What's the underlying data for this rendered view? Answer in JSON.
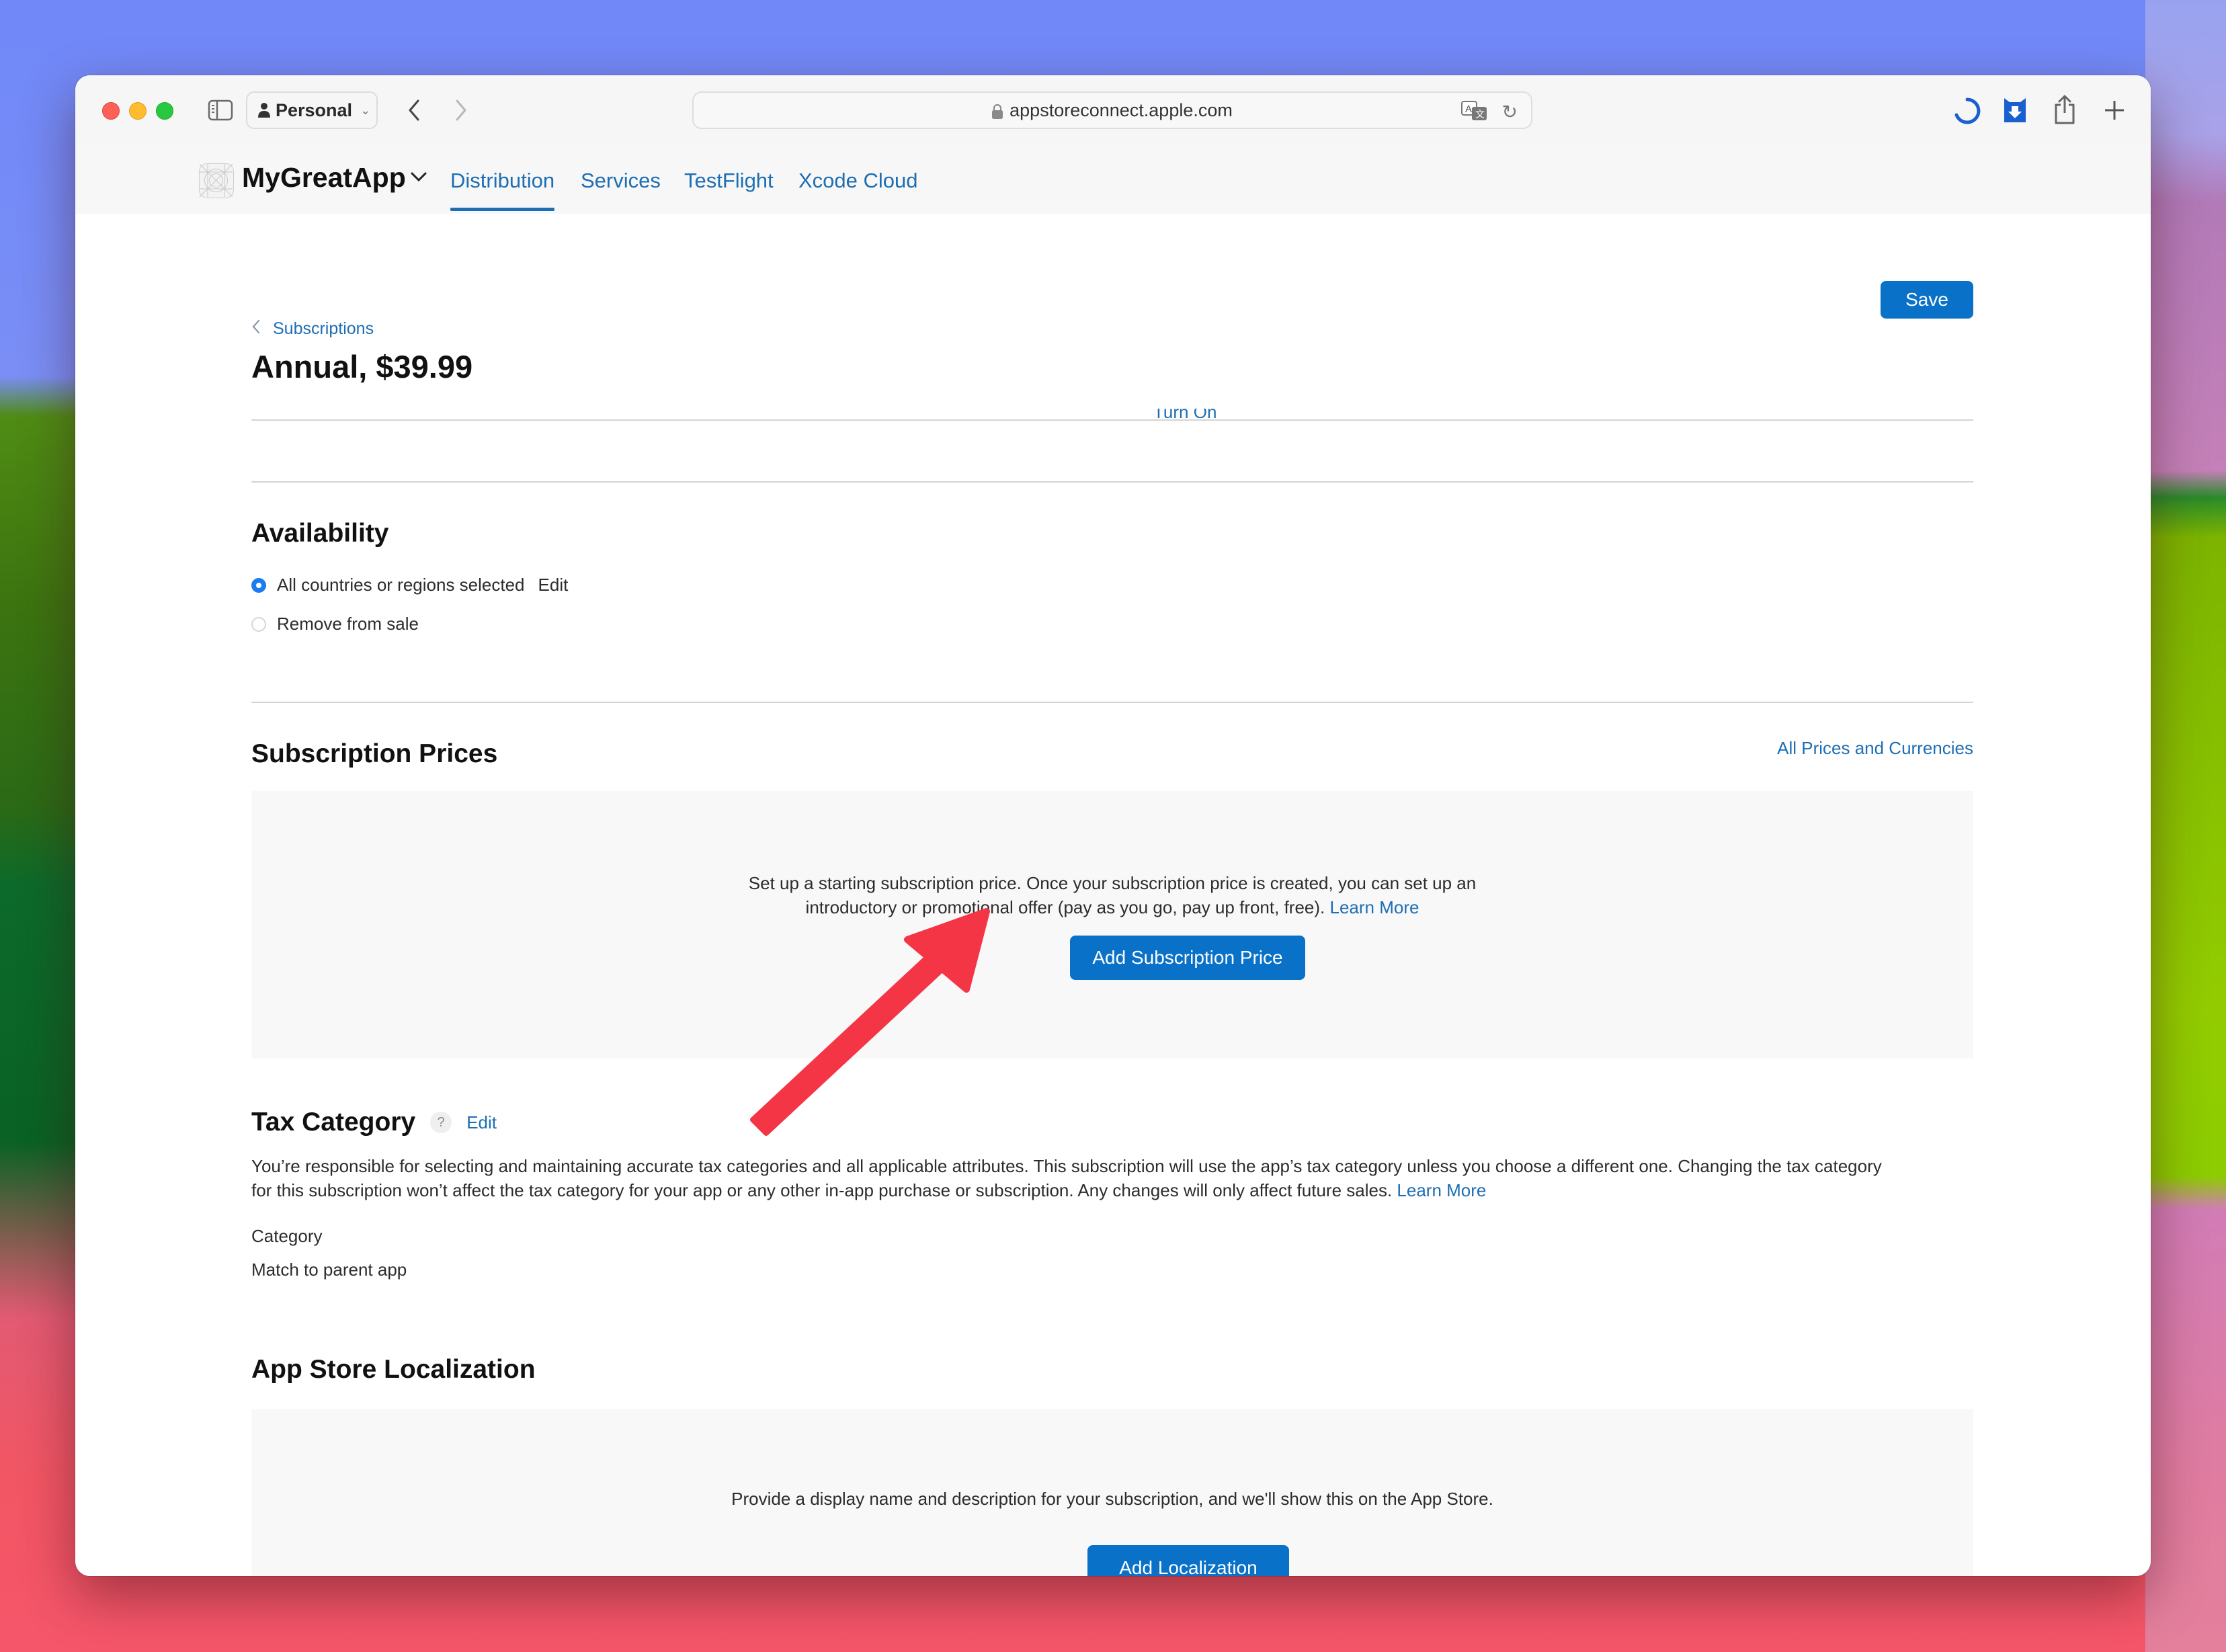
{
  "browser": {
    "profile_label": "Personal",
    "url": "appstoreconnect.apple.com",
    "accent": "#1a5fd0"
  },
  "app_header": {
    "app_name": "MyGreatApp",
    "tabs": [
      {
        "label": "Distribution",
        "active": true
      },
      {
        "label": "Services",
        "active": false
      },
      {
        "label": "TestFlight",
        "active": false
      },
      {
        "label": "Xcode Cloud",
        "active": false
      }
    ]
  },
  "page": {
    "breadcrumb": "Subscriptions",
    "title": "Annual, $39.99",
    "save_label": "Save",
    "clipped_link": "Turn On"
  },
  "availability": {
    "heading": "Availability",
    "options": [
      {
        "label": "All countries or regions selected",
        "selected": true,
        "action": "Edit"
      },
      {
        "label": "Remove from sale",
        "selected": false
      }
    ]
  },
  "subscription_prices": {
    "heading": "Subscription Prices",
    "header_link": "All Prices and Currencies",
    "description_line1": "Set up a starting subscription price. Once your subscription price is created, you can set up an",
    "description_line2": "introductory or promotional offer (pay as you go, pay up front, free).",
    "learn_more": "Learn More",
    "button_label": "Add Subscription Price"
  },
  "tax_category": {
    "heading": "Tax Category",
    "help": "?",
    "edit": "Edit",
    "description_line1": "You’re responsible for selecting and maintaining accurate tax categories and all applicable attributes. This subscription will use the app’s tax category unless you choose a different one. Changing the tax category",
    "description_line2": "for this subscription won’t affect the tax category for your app or any other in-app purchase or subscription. Any changes will only affect future sales.",
    "learn_more": "Learn More",
    "field_label": "Category",
    "field_value": "Match to parent app"
  },
  "localization": {
    "heading": "App Store Localization",
    "description": "Provide a display name and description for your subscription, and we'll show this on the App Store.",
    "button_label": "Add Localization"
  },
  "annotation": {
    "type": "arrow",
    "color": "#f43546",
    "points_to": "Add Subscription Price"
  }
}
